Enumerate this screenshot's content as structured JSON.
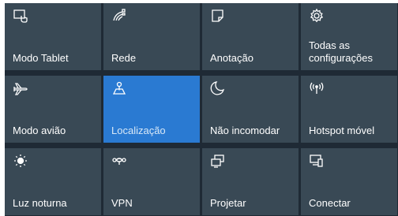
{
  "quick_actions": {
    "row1": [
      {
        "label": "Modo Tablet",
        "icon": "tablet-mode-icon"
      },
      {
        "label": "Rede",
        "icon": "network-icon"
      },
      {
        "label": "Anotação",
        "icon": "note-icon"
      },
      {
        "label": "Todas as configurações",
        "icon": "gear-icon"
      }
    ],
    "row2": [
      {
        "label": "Modo avião",
        "icon": "airplane-icon"
      },
      {
        "label": "Localização",
        "icon": "location-icon",
        "state": "on"
      },
      {
        "label": "Não incomodar",
        "icon": "moon-icon"
      },
      {
        "label": "Hotspot móvel",
        "icon": "hotspot-icon"
      }
    ],
    "row3": [
      {
        "label": "Luz noturna",
        "icon": "night-light-icon"
      },
      {
        "label": "VPN",
        "icon": "vpn-icon"
      },
      {
        "label": "Projetar",
        "icon": "project-icon"
      },
      {
        "label": "Conectar",
        "icon": "connect-icon"
      }
    ]
  },
  "colors": {
    "tile_background": "#394955",
    "active_tile_background": "#2a7ad2",
    "panel_background": "#1f2a35",
    "text": "#ffffff"
  }
}
